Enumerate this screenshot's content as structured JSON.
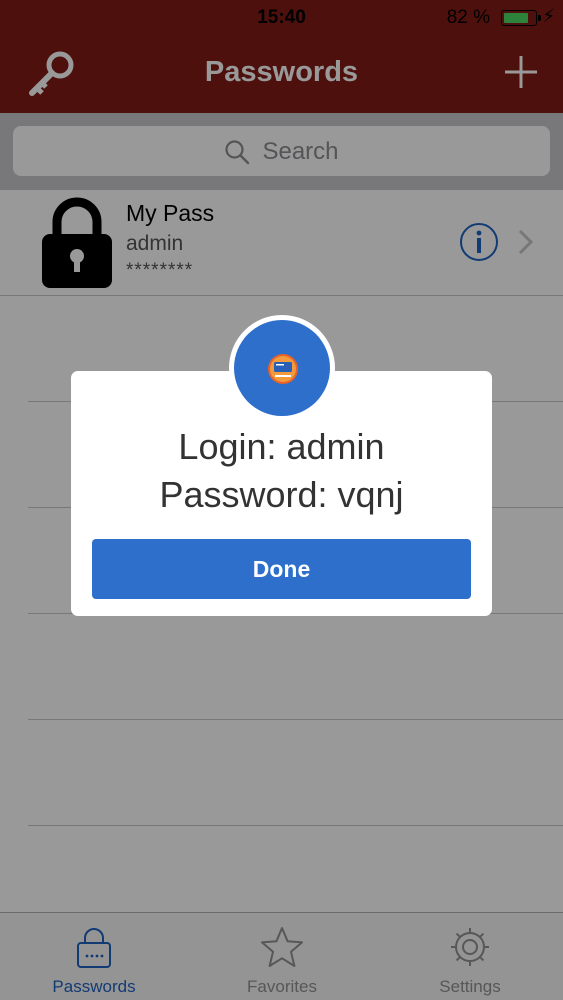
{
  "status_bar": {
    "time": "15:40",
    "battery_text": "82 %",
    "battery_level": 0.82
  },
  "nav": {
    "title": "Passwords",
    "left_icon": "key-icon",
    "right_icon": "plus-icon"
  },
  "search": {
    "placeholder": "Search"
  },
  "entries": [
    {
      "title": "My Pass",
      "username": "admin",
      "password_mask": "********"
    }
  ],
  "dialog": {
    "login_line": "Login: admin",
    "password_line": "Password: vqnj",
    "done_label": "Done"
  },
  "tabs": [
    {
      "label": "Passwords",
      "icon": "lock-tab-icon",
      "active": true
    },
    {
      "label": "Favorites",
      "icon": "star-icon",
      "active": false
    },
    {
      "label": "Settings",
      "icon": "gear-icon",
      "active": false
    }
  ],
  "colors": {
    "nav_background": "#801c16",
    "accent_blue": "#2d6fcb",
    "battery_green": "#4cd964"
  }
}
